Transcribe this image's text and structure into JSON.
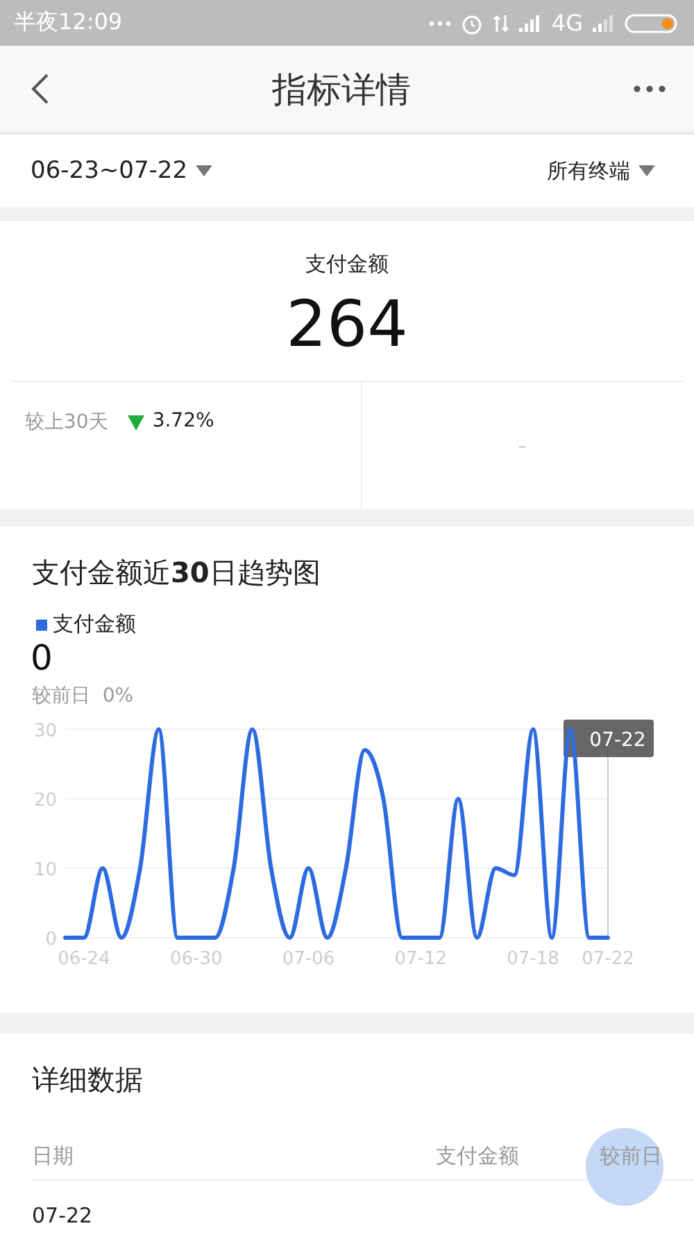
{
  "status_bar": {
    "time": "半夜12:09",
    "network": "4G"
  },
  "nav": {
    "title": "指标详情"
  },
  "filters": {
    "date_range": "06-23~07-22",
    "terminal": "所有终端"
  },
  "summary": {
    "label": "支付金额",
    "value": "264",
    "compare_label": "较上30天",
    "decrease": true,
    "change": "3.72%",
    "other": "–"
  },
  "trend": {
    "title": "支付金额近**30**日趋势图",
    "value": "0",
    "compare": "较前日  0%",
    "tooltip": "07-22",
    "chart_data": {
      "type": "line",
      "categories": [
        null,
        "06-24",
        null,
        null,
        null,
        null,
        null,
        "06-30",
        null,
        null,
        null,
        null,
        null,
        "07-06",
        null,
        null,
        null,
        null,
        null,
        "07-12",
        null,
        null,
        null,
        null,
        null,
        "07-18",
        null,
        null,
        null,
        "07-22"
      ],
      "series": [
        {
          "name": "支付金额",
          "color": "#2e6be0",
          "values": [
            0,
            0,
            10,
            0,
            10,
            30,
            0,
            0,
            0,
            10,
            30,
            10,
            0,
            10,
            0,
            10,
            27,
            20,
            0,
            0,
            0,
            20,
            0,
            10,
            9,
            30,
            0,
            30,
            0,
            0
          ]
        }
      ],
      "ylim": [
        0,
        30
      ],
      "yticks": [
        0,
        10,
        20,
        30
      ]
    }
  },
  "details": {
    "title": "详细数据",
    "columns": [
      "日期",
      "支付金额",
      "较前日"
    ],
    "rows": [
      {
        "date": "07-22"
      }
    ]
  }
}
